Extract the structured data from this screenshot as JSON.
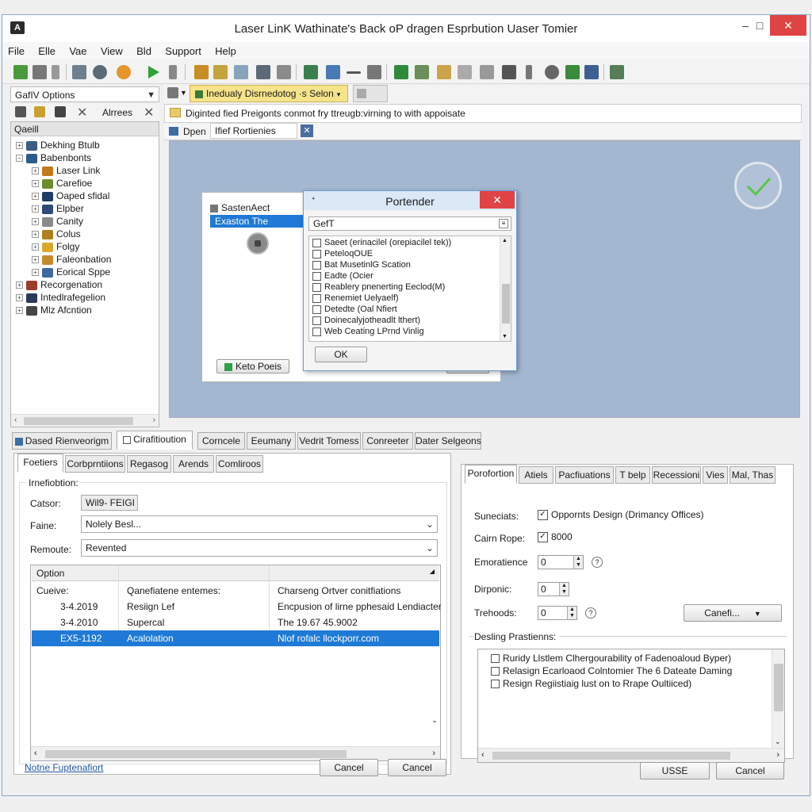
{
  "window": {
    "title": "Laser LinK Wathinate's Back oP dragen Esprbution Uaser Tomier",
    "minimize": "–",
    "maximize": "□",
    "close": "✕"
  },
  "menu": [
    "File",
    "Elle",
    "Vae",
    "View",
    "Bld",
    "Support",
    "Help"
  ],
  "left_panel": {
    "options_select": "GafIV Options",
    "toolbar_label": "Alrrees",
    "header": "Qaeill",
    "tree": [
      {
        "label": "Dekhing Btulb",
        "level": 0
      },
      {
        "label": "Babenbonts",
        "level": 0
      },
      {
        "label": "Laser Link",
        "level": 1
      },
      {
        "label": "Carefioe",
        "level": 1
      },
      {
        "label": "Oaped sfidal",
        "level": 1
      },
      {
        "label": "Elpber",
        "level": 1
      },
      {
        "label": "Canity",
        "level": 1
      },
      {
        "label": "Colus",
        "level": 1
      },
      {
        "label": "Folgy",
        "level": 1
      },
      {
        "label": "Faleonbation",
        "level": 1
      },
      {
        "label": "Eorical Sppe",
        "level": 1
      },
      {
        "label": "Recorgenation",
        "level": 0
      },
      {
        "label": "Intedlrafegelion",
        "level": 0
      },
      {
        "label": "Mlz Afcntion",
        "level": 0
      }
    ]
  },
  "right_top": {
    "dropdown_label": "Inedualy Disrnedotog ·s Selon",
    "info_text": "Diginted fied Preigonts conmot fry ttreugb:virning to with appoisate",
    "open_label": "Dpen",
    "field_label": "Ifief Rortienies"
  },
  "inner_dialog": {
    "item1": "SastenAect",
    "item2": "Exaston The",
    "bottom_button": "Keto Poeis",
    "right_button": "Laze"
  },
  "modal": {
    "title": "Portender",
    "search_value": "GefT",
    "items": [
      "Saeet (erinacilel (orepiacilel tek))",
      "PeteloqOUE",
      "Bat MusetinlG Scation",
      "Eadte (Ocier",
      "Reablery pnenerting Eeclod(M)",
      "Renemiet Uelyaelf)",
      "Detedte (Oal Nfiert",
      "Doinecalyjotheadlt lthert)",
      "Web Ceating LPrnd Vinlig"
    ],
    "ok": "OK"
  },
  "bottom_tabs": [
    "Dased Rienveorigm",
    "Cirafitioution",
    "Corncele",
    "Eeumany",
    "Vedrit Tomess",
    "Conreeter",
    "Dater Selgeons"
  ],
  "left_form": {
    "tabs": [
      "Foetiers",
      "Corbprntiions",
      "Regasog",
      "Arends",
      "Comliroos"
    ],
    "group_label": "Irnefiobtion:",
    "catsor_label": "Catsor:",
    "catsor_value": "Wil9- FEIGI",
    "faine_label": "Faine:",
    "faine_value": "Nolely Besl...",
    "remoute_label": "Remoute:",
    "remoute_value": "Revented",
    "table": {
      "headers": [
        "Option",
        "",
        ""
      ],
      "subheaders": [
        "Cueive:",
        "Qanefiatene entemes:",
        "Charseng Ortver conitfiations"
      ],
      "rows": [
        [
          "3-4.2019",
          "Resiign Lef",
          "Encpusion of lirne pphesaid Lendiacter"
        ],
        [
          "3-4.2010",
          "Supercal",
          "The 19.67 45.9002"
        ],
        [
          "EX5-1192",
          "Acalolation",
          "Nlof rofalc llockporr.com"
        ]
      ]
    },
    "link": "Notne Fuptenafiort",
    "cancel1": "Cancel",
    "cancel2": "Cancel"
  },
  "right_form": {
    "tabs": [
      "Porofortion",
      "Atiels",
      "Pacfiuations",
      "T belp",
      "Recessioni",
      "Vies",
      "Mal, Thas"
    ],
    "suneciats_label": "Suneciats:",
    "suneciats_value": "Oppornts Design (Drimancy Offices)",
    "cairn_label": "Cairn Rope:",
    "cairn_value": "8000",
    "emorience_label": "Emoratience",
    "emorience_value": "0",
    "diponic_label": "Dirponic:",
    "diponic_value": "0",
    "trehoods_label": "Trehoods:",
    "trehoods_value": "0",
    "dropdown_button": "Canefi...",
    "list_label": "Desling Prastienns:",
    "list_items": [
      "Ruridy Llstlem Clhergourability of Fadenoaloud Byper)",
      "Relasign Ecarloaod Colntomier  The 6 Dateate Daming",
      "Resign Regiistiaig lust on to Rrape Oultiiced)"
    ],
    "use_button": "USSE",
    "cancel_button": "Cancel"
  },
  "colors": {
    "accent": "#1e7ad6",
    "modal_title": "#dbe8f6",
    "dropdown_highlight": "#f7e38a",
    "close_red": "#e04343",
    "canvas": "#a4b7d1"
  }
}
